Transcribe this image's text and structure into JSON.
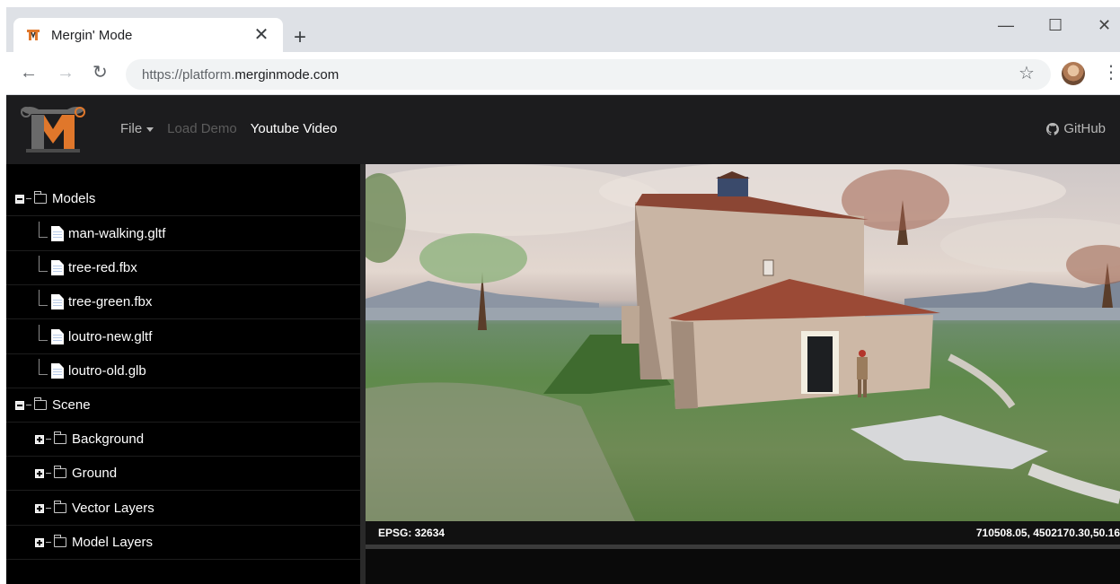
{
  "browser": {
    "tab_title": "Mergin' Mode",
    "tab_close": "✕",
    "new_tab": "+",
    "url_scheme": "https://platform.",
    "url_host": "merginmode.com",
    "window_min": "—",
    "window_max": "☐",
    "window_close": "✕",
    "back": "←",
    "forward": "→",
    "reload": "↻",
    "bookmark": "☆",
    "menu": "⋮"
  },
  "app": {
    "menu": {
      "file": "File",
      "load_demo": "Load Demo",
      "youtube": "Youtube Video"
    },
    "github": "GitHub"
  },
  "tree": {
    "models": {
      "label": "Models",
      "files": [
        "man-walking.gltf",
        "tree-red.fbx",
        "tree-green.fbx",
        "loutro-new.gltf",
        "loutro-old.glb"
      ]
    },
    "scene": {
      "label": "Scene",
      "groups": [
        "Background",
        "Ground",
        "Vector Layers",
        "Model Layers"
      ]
    }
  },
  "status": {
    "epsg": "EPSG: 32634",
    "coords": "710508.05, 4502170.30,50.16"
  },
  "colors": {
    "app_bg": "#1c1c1e",
    "sidebar_bg": "#000000",
    "logo_orange": "#e0772b"
  }
}
